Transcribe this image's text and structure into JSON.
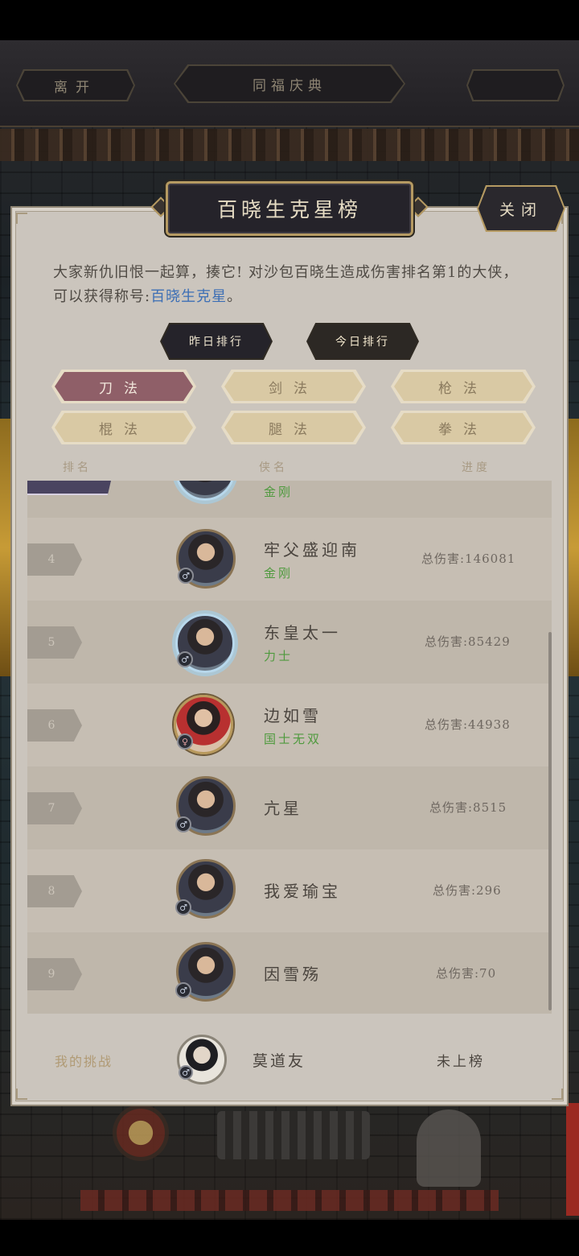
{
  "topbar": {
    "leave_label": "离开",
    "event_title": "同福庆典",
    "right_label": ""
  },
  "dialog": {
    "title": "百晓生克星榜",
    "close_label": "关闭",
    "description": "大家新仇旧恨一起算，揍它! 对沙包百晓生造成伤害排名第1的大侠，可以获得称号:",
    "reward_title": "百晓生克星",
    "description_end": "。"
  },
  "day_tabs": [
    {
      "label": "昨日排行",
      "active": false
    },
    {
      "label": "今日排行",
      "active": true
    }
  ],
  "categories": [
    {
      "label": "刀法",
      "active": true
    },
    {
      "label": "剑法",
      "active": false
    },
    {
      "label": "枪法",
      "active": false
    },
    {
      "label": "棍法",
      "active": false
    },
    {
      "label": "腿法",
      "active": false
    },
    {
      "label": "拳法",
      "active": false
    }
  ],
  "columns": {
    "rank": "排名",
    "name": "侠名",
    "progress": "进度"
  },
  "partial_row": {
    "title": "金刚"
  },
  "rows": [
    {
      "rank": "4",
      "name": "牢父盛迎南",
      "title": "金刚",
      "damage": "总伤害:146081",
      "gender": "♂",
      "frame": "plain"
    },
    {
      "rank": "5",
      "name": "东皇太一",
      "title": "力士",
      "damage": "总伤害:85429",
      "gender": "♂",
      "frame": "frost"
    },
    {
      "rank": "6",
      "name": "边如雪",
      "title": "国士无双",
      "damage": "总伤害:44938",
      "gender": "♀",
      "frame": "gold"
    },
    {
      "rank": "7",
      "name": "亢星",
      "title": "",
      "damage": "总伤害:8515",
      "gender": "♂",
      "frame": "plain"
    },
    {
      "rank": "8",
      "name": "我爱瑜宝",
      "title": "",
      "damage": "总伤害:296",
      "gender": "♂",
      "frame": "plain"
    },
    {
      "rank": "9",
      "name": "因雪殇",
      "title": "",
      "damage": "总伤害:70",
      "gender": "♂",
      "frame": "plain"
    }
  ],
  "my_challenge": {
    "label": "我的挑战",
    "name": "莫道友",
    "status": "未上榜",
    "gender": "♂"
  }
}
